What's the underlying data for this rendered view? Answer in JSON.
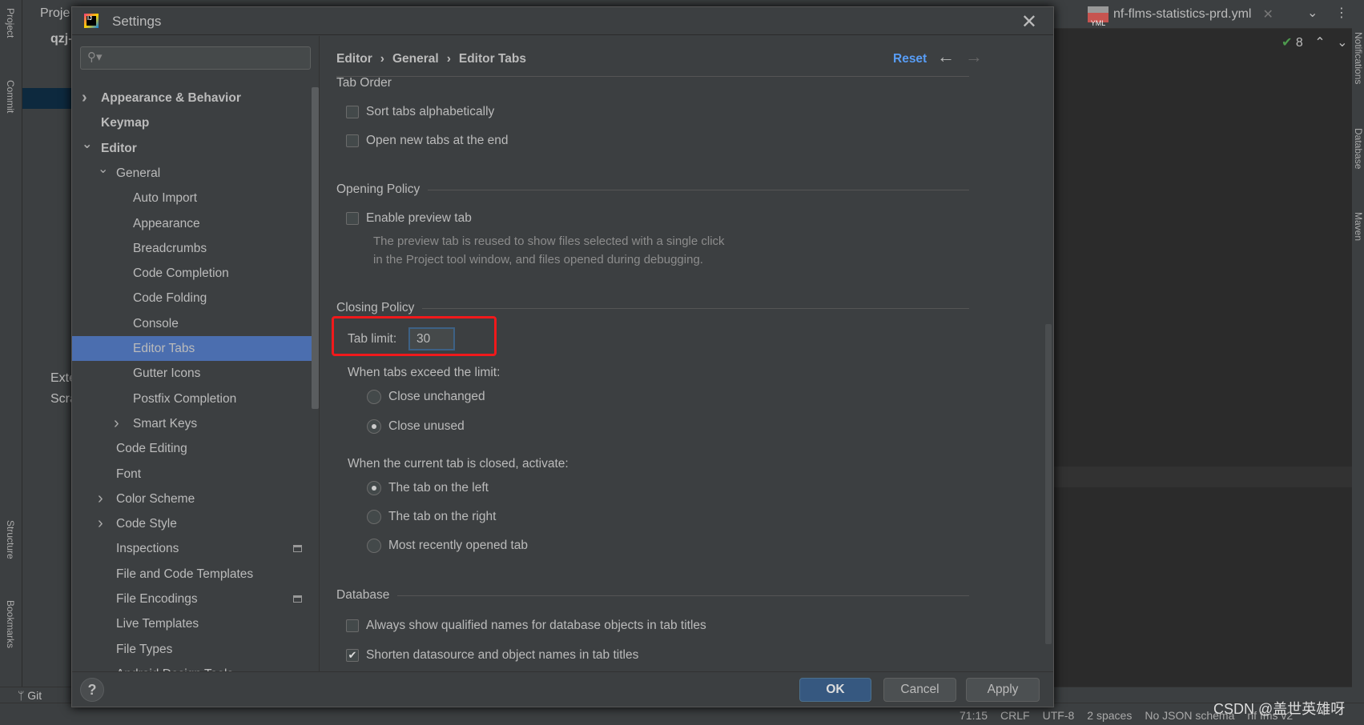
{
  "ide": {
    "project_tab": "Proje",
    "project_root": "qzj-",
    "tree_items": [
      "Exte",
      "Scra"
    ],
    "editor_tabs": [
      "nf-flms-statistics-prd.yml"
    ],
    "inspection_count": "8",
    "right_tools": [
      "Notifications",
      "Database",
      "Maven"
    ],
    "left_tools": [
      "Project",
      "Commit",
      "Structure",
      "Bookmarks"
    ],
    "git_label": "Git",
    "status": [
      "71:15",
      "CRLF",
      "UTF-8",
      "2 spaces",
      "No JSON schema",
      "nf fms v2"
    ],
    "watermark": "CSDN @盖世英雄呀"
  },
  "dialog": {
    "title": "Settings",
    "search_placeholder": "",
    "sidebar": [
      {
        "label": "Appearance & Behavior",
        "level": 0,
        "bold": true,
        "chevron": "right"
      },
      {
        "label": "Keymap",
        "level": 0,
        "bold": true
      },
      {
        "label": "Editor",
        "level": 0,
        "bold": true,
        "chevron": "down"
      },
      {
        "label": "General",
        "level": 1,
        "chevron": "down"
      },
      {
        "label": "Auto Import",
        "level": 2
      },
      {
        "label": "Appearance",
        "level": 2
      },
      {
        "label": "Breadcrumbs",
        "level": 2
      },
      {
        "label": "Code Completion",
        "level": 2
      },
      {
        "label": "Code Folding",
        "level": 2
      },
      {
        "label": "Console",
        "level": 2
      },
      {
        "label": "Editor Tabs",
        "level": 2,
        "selected": true
      },
      {
        "label": "Gutter Icons",
        "level": 2
      },
      {
        "label": "Postfix Completion",
        "level": 2
      },
      {
        "label": "Smart Keys",
        "level": 2,
        "chevron": "right"
      },
      {
        "label": "Code Editing",
        "level": 1
      },
      {
        "label": "Font",
        "level": 1
      },
      {
        "label": "Color Scheme",
        "level": 1,
        "chevron": "right"
      },
      {
        "label": "Code Style",
        "level": 1,
        "chevron": "right"
      },
      {
        "label": "Inspections",
        "level": 1,
        "badge": true
      },
      {
        "label": "File and Code Templates",
        "level": 1
      },
      {
        "label": "File Encodings",
        "level": 1,
        "badge": true
      },
      {
        "label": "Live Templates",
        "level": 1
      },
      {
        "label": "File Types",
        "level": 1
      },
      {
        "label": "Android Design Tools",
        "level": 1
      }
    ],
    "breadcrumb": [
      "Editor",
      "General",
      "Editor Tabs"
    ],
    "reset": "Reset",
    "tab_order": {
      "title": "Tab Order",
      "sort_alpha": "Sort tabs alphabetically",
      "sort_alpha_checked": false,
      "open_end": "Open new tabs at the end",
      "open_end_checked": false
    },
    "opening": {
      "title": "Opening Policy",
      "preview": "Enable preview tab",
      "preview_checked": false,
      "desc1": "The preview tab is reused to show files selected with a single click",
      "desc2": "in the Project tool window, and files opened during debugging."
    },
    "closing": {
      "title": "Closing Policy",
      "tab_limit_label": "Tab limit:",
      "tab_limit": "30",
      "exceed_label": "When tabs exceed the limit:",
      "close_unchanged": "Close unchanged",
      "close_unused": "Close unused",
      "exceed_selected": "close_unused",
      "activate_label": "When the current tab is closed, activate:",
      "left": "The tab on the left",
      "right": "The tab on the right",
      "recent": "Most recently opened tab",
      "activate_selected": "left",
      "highlight_color": "#f0191b"
    },
    "database": {
      "title": "Database",
      "qualified": "Always show qualified names for database objects in tab titles",
      "qualified_checked": false,
      "shorten": "Shorten datasource and object names in tab titles",
      "shorten_checked": true
    },
    "buttons": {
      "help": "?",
      "ok": "OK",
      "cancel": "Cancel",
      "apply": "Apply"
    },
    "accent": "#4b6eaf"
  }
}
